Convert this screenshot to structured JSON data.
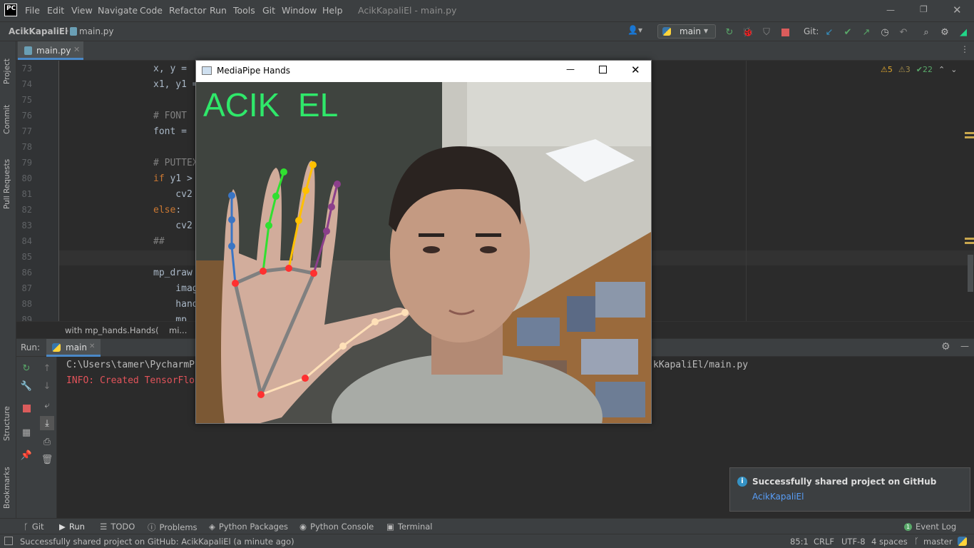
{
  "titlebar": {
    "app_logo": "PC",
    "menus": [
      "File",
      "Edit",
      "View",
      "Navigate",
      "Code",
      "Refactor",
      "Run",
      "Tools",
      "Git",
      "Window",
      "Help"
    ],
    "window_title": "AcikKapaliEl - main.py"
  },
  "navbar": {
    "project": "AcikKapaliEl",
    "file": "main.py",
    "run_config": "main",
    "git_label": "Git:"
  },
  "tabs": [
    {
      "label": "main.py"
    }
  ],
  "left_stripe": {
    "project": "Project",
    "commit": "Commit",
    "pull_requests": "Pull Requests",
    "structure": "Structure",
    "bookmarks": "Bookmarks"
  },
  "inspections": {
    "warnings": "5",
    "weak_warnings": "3",
    "ok": "22"
  },
  "code_lines": [
    {
      "n": "73",
      "text": "x, y = "
    },
    {
      "n": "74",
      "text": "x1, y1 ="
    },
    {
      "n": "75",
      "text": ""
    },
    {
      "n": "76",
      "text": "# FONT "
    },
    {
      "n": "77",
      "text": "font = "
    },
    {
      "n": "78",
      "text": ""
    },
    {
      "n": "79",
      "text": "# PUTTEX"
    },
    {
      "n": "80",
      "text": "if y1 > "
    },
    {
      "n": "81",
      "text": "    cv2"
    },
    {
      "n": "82",
      "text": "else:"
    },
    {
      "n": "83",
      "text": "    cv2"
    },
    {
      "n": "84",
      "text": "##"
    },
    {
      "n": "85",
      "text": ""
    },
    {
      "n": "86",
      "text": "mp_draw"
    },
    {
      "n": "87",
      "text": "    imag"
    },
    {
      "n": "88",
      "text": "    hand"
    },
    {
      "n": "89",
      "text": "    mp_"
    }
  ],
  "breadcrumb": {
    "a": "with mp_hands.Hands(",
    "b": "mi..."
  },
  "run_panel": {
    "run_label": "Run:",
    "tab": "main",
    "cmd_line": "C:\\Users\\tamer\\PycharmP",
    "cmd_line_end": "kKapaliEl/main.py",
    "info_line": "INFO: Created TensorFlo"
  },
  "bottom_tabs": [
    "Git",
    "Run",
    "TODO",
    "Problems",
    "Python Packages",
    "Python Console",
    "Terminal"
  ],
  "event_log": "Event Log",
  "status": {
    "message": "Successfully shared project on GitHub: AcikKapaliEl (a minute ago)",
    "position": "85:1",
    "line_sep": "CRLF",
    "encoding": "UTF-8",
    "indent": "4 spaces",
    "branch": "master"
  },
  "notification": {
    "title": "Successfully shared project on GitHub",
    "link": "AcikKapaliEl"
  },
  "mediapipe": {
    "window_title": "MediaPipe Hands",
    "overlay_text": "ACIK  EL",
    "overlay_color": "#2fe86a"
  }
}
